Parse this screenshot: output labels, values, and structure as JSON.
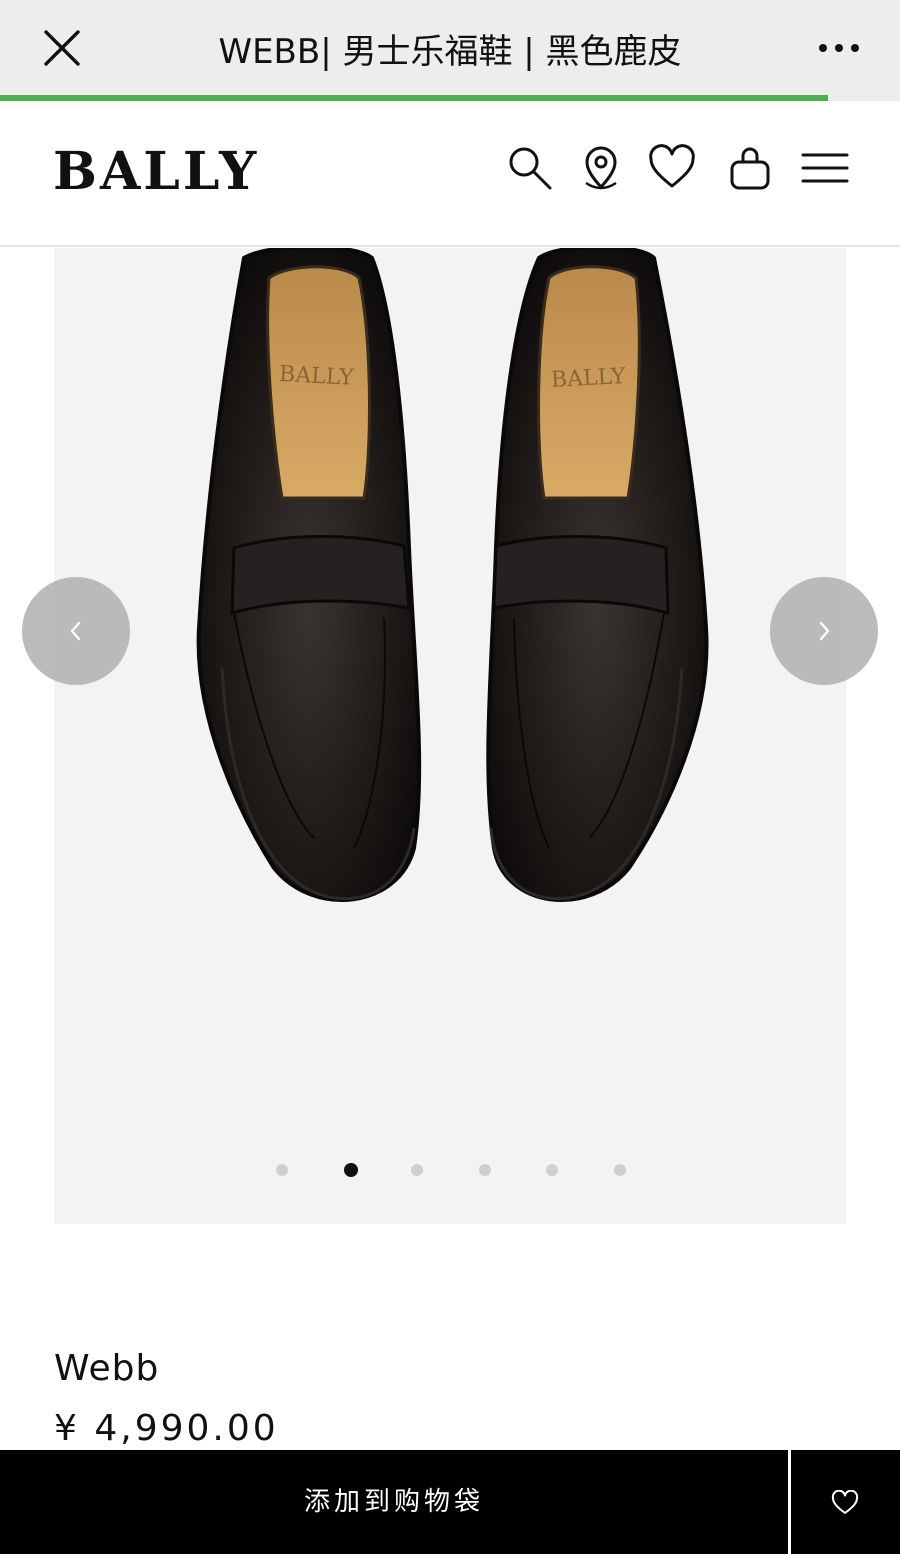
{
  "topbar": {
    "title": "WEBB| 男士乐福鞋 | 黑色鹿皮",
    "close_icon": "close-icon",
    "more_icon": "more-dots-icon",
    "load_progress": 0.92,
    "progress_color": "#4caf50"
  },
  "header": {
    "logo": "BALLY",
    "icons": [
      "search-icon",
      "store-locator-icon",
      "wishlist-heart-icon",
      "shopping-bag-icon",
      "menu-icon"
    ]
  },
  "gallery": {
    "image_count": 6,
    "active_index": 1,
    "prev_icon": "chevron-left-icon",
    "next_icon": "chevron-right-icon",
    "insole_brand": "BALLY"
  },
  "product": {
    "name": "Webb",
    "price": "¥ 4,990.00"
  },
  "actions": {
    "add_to_bag": "添加到购物袋",
    "wishlist_icon": "heart-outline-icon"
  }
}
